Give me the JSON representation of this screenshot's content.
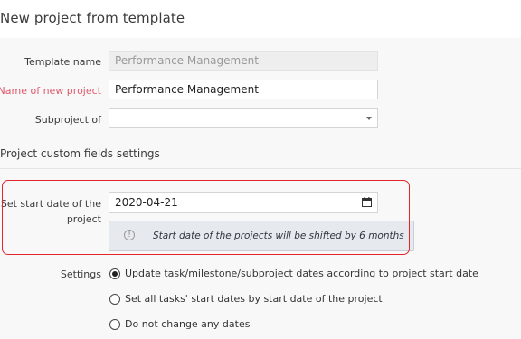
{
  "page": {
    "title": "New project from template"
  },
  "form": {
    "template_name": {
      "label": "Template name",
      "value": "Performance Management"
    },
    "new_project_name": {
      "label": "Name of new project",
      "value": "Performance Management"
    },
    "subproject_of": {
      "label": "Subproject of",
      "value": ""
    }
  },
  "custom_fields": {
    "section_title": "Project custom fields settings",
    "start_date": {
      "label_line1": "Set start date of the",
      "label_line2": "project",
      "value": "2020-04-21",
      "calendar_icon": "calendar-icon"
    },
    "info": {
      "icon": "info-icon",
      "text": "Start date of the projects will be shifted by 6 months"
    }
  },
  "settings": {
    "label": "Settings",
    "options": [
      {
        "label": "Update task/milestone/subproject dates according to project start date",
        "checked": true
      },
      {
        "label": "Set all tasks' start dates by start date of the project",
        "checked": false
      },
      {
        "label": "Do not change any dates",
        "checked": false
      }
    ]
  },
  "colors": {
    "required_label": "#e2586a",
    "highlight_border": "#e2262b",
    "info_bg": "#e6e9ee"
  }
}
